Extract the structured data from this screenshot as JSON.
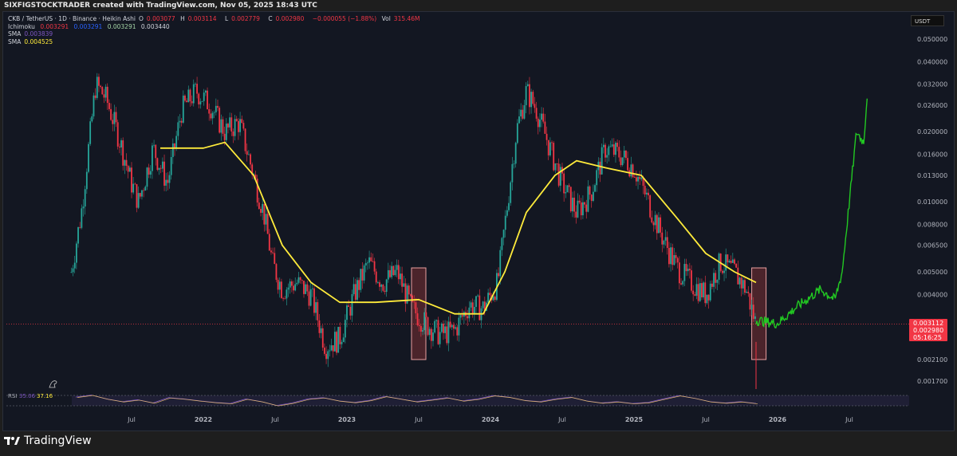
{
  "header": {
    "caption": "SIXFIGSTOCKTRADER created with TradingView.com, Nov 05, 2025 18:43 UTC"
  },
  "legend": {
    "symbol": "CKB / TetherUS · 1D · Binance · Heikin Ashi",
    "o_label": "O",
    "o": "0.003077",
    "h_label": "H",
    "h": "0.003114",
    "l_label": "L",
    "l": "0.002779",
    "c_label": "C",
    "c": "0.002980",
    "change": "−0.000055 (−1.88%)",
    "vol_label": "Vol",
    "vol": "315.46M",
    "ichimoku_label": "Ichimoku",
    "ichimoku": [
      "0.003291",
      "0.003291",
      "0.003291",
      "0.003440"
    ],
    "sma1_label": "SMA",
    "sma1": "0.003839",
    "sma2_label": "SMA",
    "sma2": "0.004525"
  },
  "currency": "USDT",
  "price_tags": {
    "high": "0.003112",
    "last": "0.002980",
    "countdown": "05:16:25"
  },
  "rsi": {
    "label": "RSI",
    "v1": "35.06",
    "v2": "37.16"
  },
  "brand": "TradingView",
  "colors": {
    "up": "#26a69a",
    "down": "#f23645",
    "sma": "#ffeb3b",
    "sma_fast": "#7e57c2",
    "projection": "#22c922",
    "highlight": "#e8a0a0"
  },
  "chart_data": {
    "type": "line",
    "title": "CKB / TetherUS 1D Binance Heikin Ashi",
    "yscale": "log",
    "ylim": [
      0.0016,
      0.056
    ],
    "xlim": [
      2020.95,
      2026.95
    ],
    "y_ticks": [
      "0.050000",
      "0.040000",
      "0.032000",
      "0.026000",
      "0.020000",
      "0.016000",
      "0.013000",
      "0.010000",
      "0.008000",
      "0.006500",
      "0.005000",
      "0.004000",
      "0.002100",
      "0.001700"
    ],
    "x_ticks": [
      {
        "t": 2021.5,
        "label": "Jul"
      },
      {
        "t": 2022,
        "label": "2022"
      },
      {
        "t": 2022.5,
        "label": "Jul"
      },
      {
        "t": 2023,
        "label": "2023"
      },
      {
        "t": 2023.5,
        "label": "Jul"
      },
      {
        "t": 2024,
        "label": "2024"
      },
      {
        "t": 2024.5,
        "label": "Jul"
      },
      {
        "t": 2025,
        "label": "2025"
      },
      {
        "t": 2025.5,
        "label": "Jul"
      },
      {
        "t": 2026,
        "label": "2026"
      },
      {
        "t": 2026.5,
        "label": "Jul"
      }
    ],
    "series": [
      {
        "name": "Price",
        "t": [
          2021.08,
          2021.15,
          2021.25,
          2021.32,
          2021.4,
          2021.5,
          2021.55,
          2021.65,
          2021.75,
          2021.85,
          2021.95,
          2022.05,
          2022.15,
          2022.25,
          2022.35,
          2022.42,
          2022.48,
          2022.55,
          2022.65,
          2022.75,
          2022.85,
          2022.95,
          2023.05,
          2023.15,
          2023.25,
          2023.35,
          2023.45,
          2023.55,
          2023.65,
          2023.75,
          2023.85,
          2023.95,
          2024.05,
          2024.12,
          2024.18,
          2024.25,
          2024.32,
          2024.4,
          2024.5,
          2024.6,
          2024.7,
          2024.8,
          2024.9,
          2025.0,
          2025.1,
          2025.2,
          2025.3,
          2025.4,
          2025.5,
          2025.6,
          2025.7,
          2025.78,
          2025.85
        ],
        "values": [
          0.005,
          0.009,
          0.032,
          0.028,
          0.02,
          0.012,
          0.01,
          0.017,
          0.012,
          0.025,
          0.03,
          0.026,
          0.02,
          0.022,
          0.013,
          0.009,
          0.0055,
          0.0042,
          0.0045,
          0.004,
          0.0024,
          0.0026,
          0.004,
          0.0055,
          0.0045,
          0.005,
          0.0035,
          0.003,
          0.0027,
          0.0028,
          0.0036,
          0.0035,
          0.0045,
          0.01,
          0.02,
          0.03,
          0.025,
          0.018,
          0.012,
          0.009,
          0.011,
          0.017,
          0.016,
          0.014,
          0.01,
          0.007,
          0.0052,
          0.0045,
          0.004,
          0.0055,
          0.005,
          0.0042,
          0.00298
        ]
      },
      {
        "name": "SMA",
        "t": [
          2021.7,
          2022.0,
          2022.15,
          2022.35,
          2022.55,
          2022.75,
          2022.95,
          2023.2,
          2023.5,
          2023.75,
          2023.95,
          2024.1,
          2024.25,
          2024.45,
          2024.6,
          2024.8,
          2025.05,
          2025.3,
          2025.5,
          2025.7,
          2025.85
        ],
        "values": [
          0.017,
          0.017,
          0.018,
          0.013,
          0.0065,
          0.0045,
          0.0037,
          0.0037,
          0.0038,
          0.0033,
          0.0033,
          0.005,
          0.009,
          0.013,
          0.015,
          0.014,
          0.013,
          0.0085,
          0.006,
          0.005,
          0.0045
        ]
      },
      {
        "name": "Projection",
        "t": [
          2025.85,
          2026.0,
          2026.15,
          2026.3,
          2026.4,
          2026.45,
          2026.5,
          2026.55,
          2026.6,
          2026.63
        ],
        "values": [
          0.0031,
          0.003,
          0.0036,
          0.0042,
          0.0038,
          0.005,
          0.01,
          0.02,
          0.018,
          0.032
        ]
      }
    ],
    "highlights": [
      {
        "t0": 2023.45,
        "t1": 2023.55,
        "p0": 0.0021,
        "p1": 0.0052
      },
      {
        "t0": 2025.82,
        "t1": 2025.92,
        "p0": 0.0021,
        "p1": 0.0052
      }
    ],
    "rsi_values": [
      62,
      70,
      55,
      45,
      52,
      40,
      60,
      55,
      48,
      42,
      38,
      55,
      45,
      30,
      40,
      55,
      60,
      48,
      42,
      50,
      65,
      55,
      45,
      52,
      60,
      48,
      55,
      68,
      62,
      50,
      45,
      55,
      62,
      48,
      40,
      45,
      38,
      42,
      55,
      68,
      58,
      45,
      40,
      45,
      38
    ]
  }
}
